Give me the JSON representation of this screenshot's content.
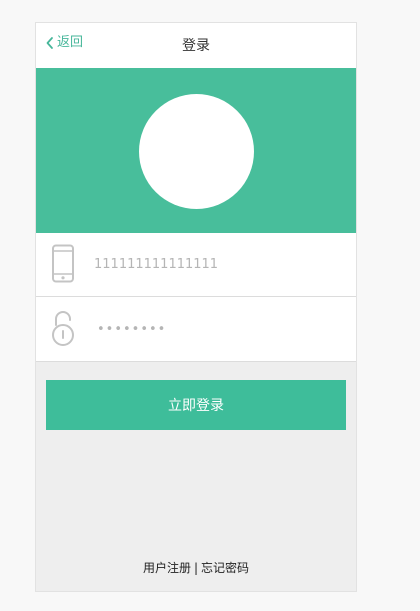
{
  "header": {
    "back_label": "返回",
    "title": "登录"
  },
  "form": {
    "phone_value": "111111111111111",
    "password_value": "••••••••"
  },
  "actions": {
    "submit_label": "立即登录"
  },
  "footer": {
    "register_label": "用户注册",
    "separator": "|",
    "forgot_label": "忘记密码"
  },
  "colors": {
    "accent": "#48be9b",
    "button": "#3ebd9a",
    "back_link": "#46b69a",
    "background": "#eeeeee"
  },
  "icons": {
    "back": "chevron-left-icon",
    "phone": "mobile-phone-icon",
    "password": "unlocked-padlock-icon"
  }
}
